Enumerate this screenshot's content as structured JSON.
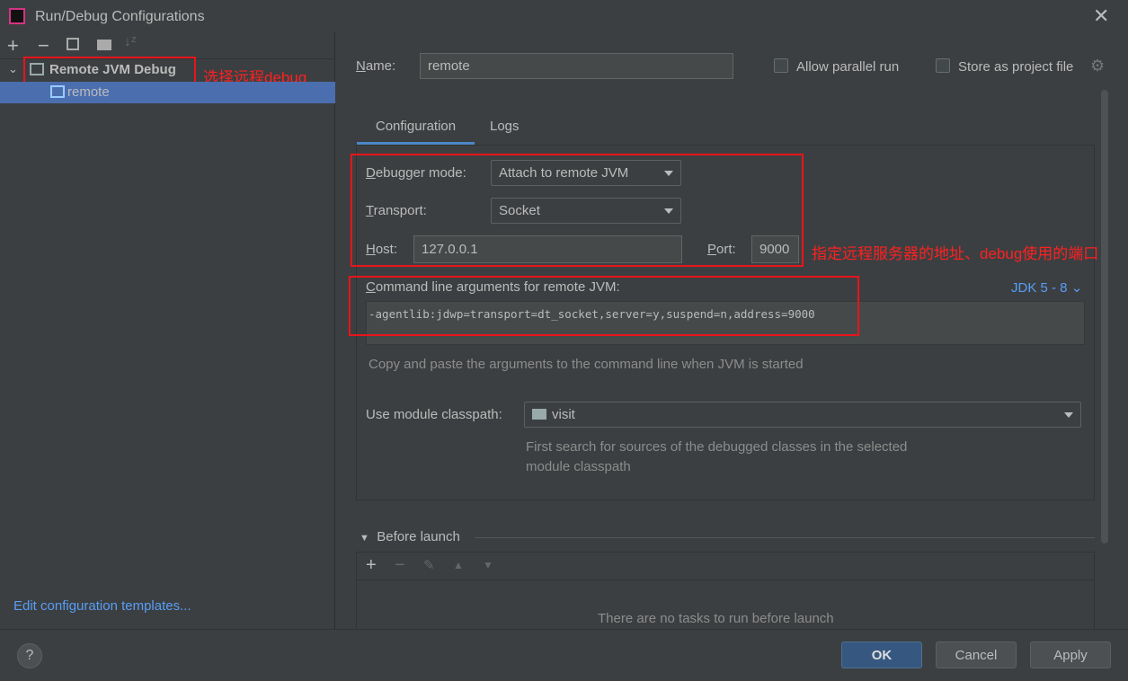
{
  "window": {
    "title": "Run/Debug Configurations"
  },
  "toolbar": {
    "icons": [
      "plus-icon",
      "minus-icon",
      "copy-icon",
      "new-folder-icon",
      "sort-icon"
    ]
  },
  "tree": {
    "group": "Remote JVM Debug",
    "item": "remote"
  },
  "annotations": {
    "select_remote": "选择远程debug",
    "host_port": "指定远程服务器的地址、debug使用的端口"
  },
  "left": {
    "templates_link": "Edit configuration templates..."
  },
  "form": {
    "name_label": "Name:",
    "name_value": "remote",
    "parallel_label": "Allow parallel run",
    "store_label": "Store as project file",
    "tabs": [
      "Configuration",
      "Logs"
    ],
    "debugger_mode_label": "Debugger mode:",
    "debugger_mode_value": "Attach to remote JVM",
    "transport_label": "Transport:",
    "transport_value": "Socket",
    "host_label": "Host:",
    "host_value": "127.0.0.1",
    "port_label": "Port:",
    "port_value": "9000",
    "cmd_label": "Command line arguments for remote JVM:",
    "jdk_select": "JDK 5 - 8",
    "cmd_value": "-agentlib:jdwp=transport=dt_socket,server=y,suspend=n,address=9000",
    "cmd_hint": "Copy and paste the arguments to the command line when JVM is started",
    "module_label": "Use module classpath:",
    "module_value": "visit",
    "module_hint_1": "First search for sources of the debugged classes in the selected",
    "module_hint_2": "module classpath",
    "before_launch": "Before launch",
    "no_tasks": "There are no tasks to run before launch"
  },
  "footer": {
    "help": "?",
    "ok": "OK",
    "cancel": "Cancel",
    "apply": "Apply"
  },
  "colors": {
    "selection": "#4b6eaf",
    "link": "#589df6",
    "annotation": "#ff2020",
    "ok_button": "#365880"
  }
}
